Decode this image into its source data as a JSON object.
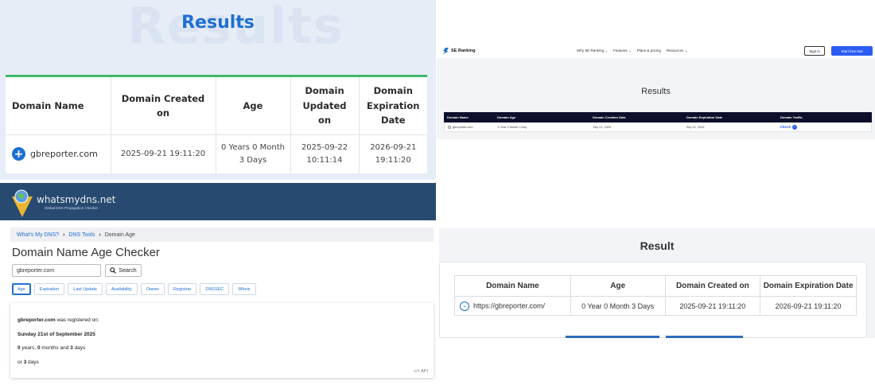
{
  "results_panel": {
    "ghost_text": "Results",
    "title": "Results",
    "headers": [
      "Domain Name",
      "Domain Created on",
      "Age",
      "Domain Updated on",
      "Domain Expiration Date"
    ],
    "row": {
      "domain": "gbreporter.com",
      "created": "2025-09-21 19:11:20",
      "age": "0 Years 0 Month 3 Days",
      "updated": "2025-09-22 10:11:14",
      "expires": "2026-09-21 19:11:20"
    },
    "colors": {
      "accent": "#1f6fd1",
      "top_border": "#3fb86a"
    }
  },
  "seranking": {
    "logo": "SE Ranking",
    "nav": [
      "Why SE Ranking ⌄",
      "Features ⌄",
      "Plans & pricing",
      "Resources ⌄"
    ],
    "sign_in": "Sign in",
    "start_trial": "Start free trial",
    "title": "Results",
    "headers": [
      "Domain Name",
      "Domain Age",
      "Domain Creation Date",
      "Domain Expiration Date",
      "Domain Traffic"
    ],
    "row": {
      "domain": "gbreporter.com",
      "age": "0 Year 0 Month 3 Day",
      "created": "Sep 21, 2025",
      "expires": "Sep 21, 2026",
      "traffic": "Check"
    },
    "colors": {
      "header_bg": "#0d0f2b",
      "cta": "#2a5cf5"
    }
  },
  "whatsmydns": {
    "brand": "whatsmydns.net",
    "tagline": "Global DNS Propagation Checker",
    "breadcrumb": [
      "What's My DNS?",
      "DNS Tools",
      "Domain Age"
    ],
    "heading": "Domain Name Age Checker",
    "search_value": "gbreporter.com",
    "search_button": "Search",
    "tabs": [
      "Age",
      "Expiration",
      "Last Update",
      "Availability",
      "Owner",
      "Registrar",
      "DNSSEC",
      "Whois"
    ],
    "result": {
      "domain": "gbreporter.com",
      "registered_suffix": " was registered on:",
      "date": "Sunday 21st of September 2025",
      "years": "0",
      "years_label": " years, ",
      "months": "0",
      "months_label": " months and ",
      "days": "3",
      "days_label": " days",
      "or_prefix": "or ",
      "or_days": "3",
      "or_suffix": " days",
      "api": "</> API"
    },
    "colors": {
      "banner": "#284a70",
      "link": "#1f6fd1"
    }
  },
  "result_panel": {
    "title": "Result",
    "headers": [
      "Domain Name",
      "Age",
      "Domain Created on",
      "Domain Expiration Date"
    ],
    "row": {
      "domain": "https://gbreporter.com/",
      "age": "0 Year 0 Month 3 Days",
      "created": "2025-09-21 19:11:20",
      "expires": "2026-09-21 19:11:20"
    }
  }
}
